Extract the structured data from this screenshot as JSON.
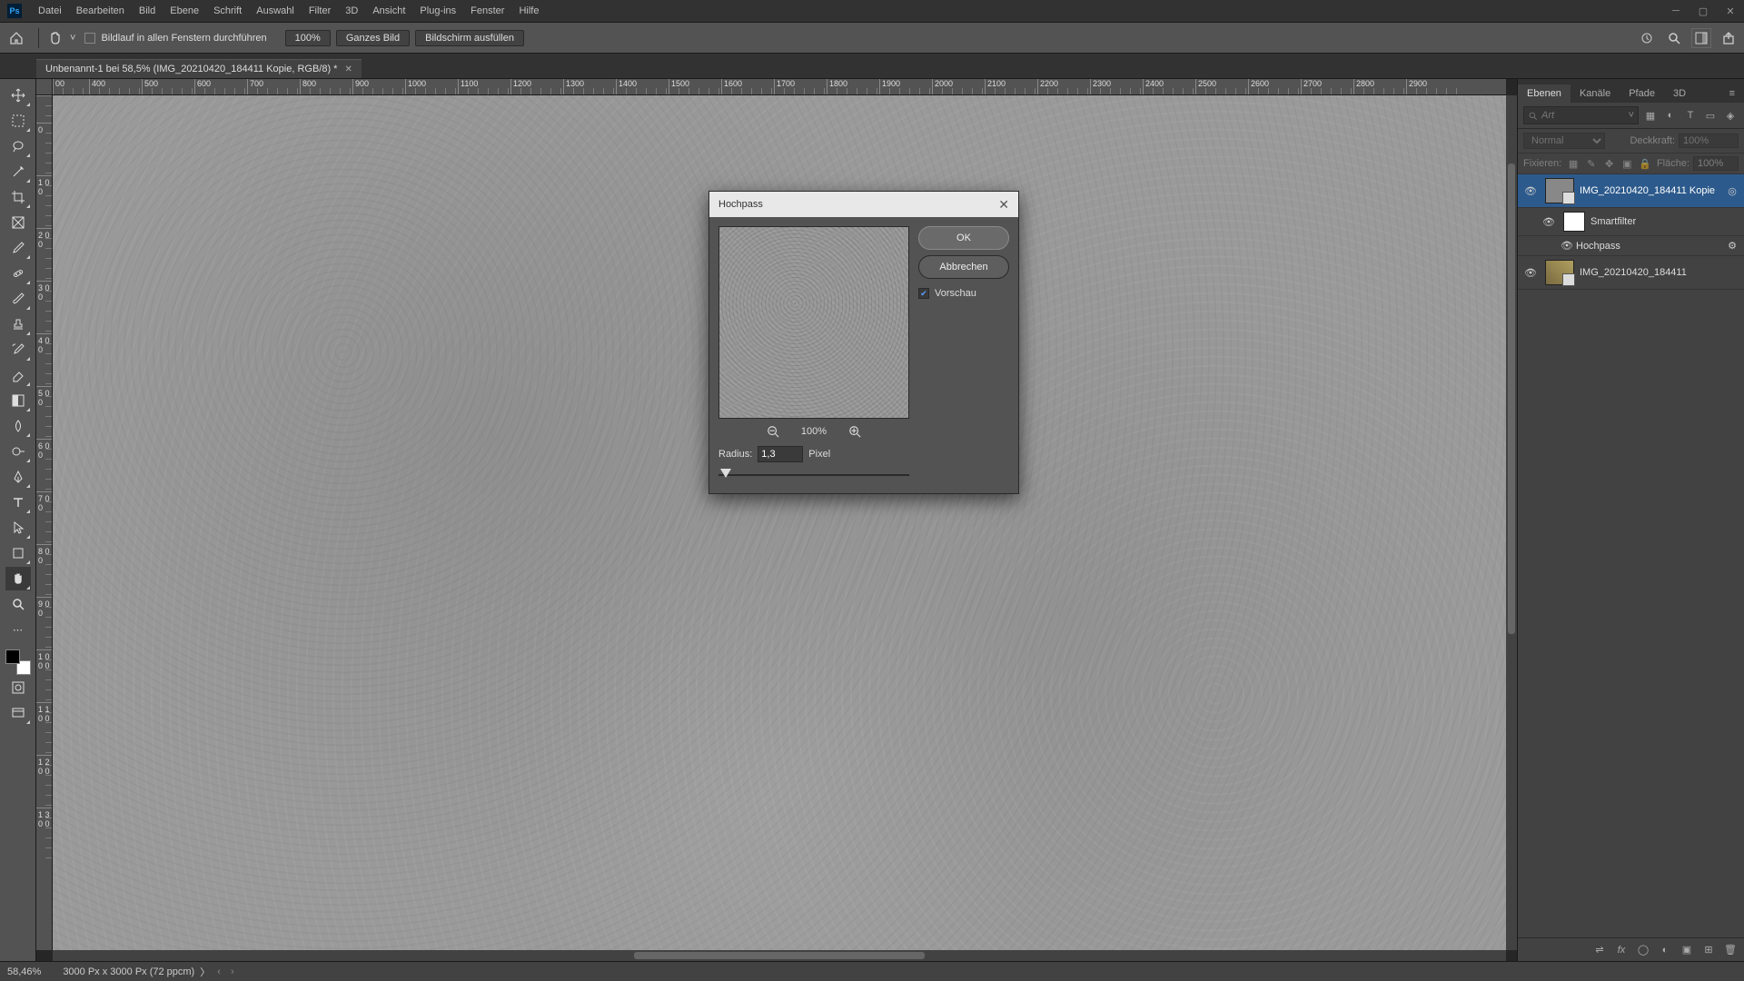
{
  "menu": [
    "Datei",
    "Bearbeiten",
    "Bild",
    "Ebene",
    "Schrift",
    "Auswahl",
    "Filter",
    "3D",
    "Ansicht",
    "Plug-ins",
    "Fenster",
    "Hilfe"
  ],
  "options": {
    "scroll_all": "Bildlauf in allen Fenstern durchführen",
    "zoom": "100%",
    "fit_image": "Ganzes Bild",
    "fill_screen": "Bildschirm ausfüllen"
  },
  "doc_tab": "Unbenannt-1 bei 58,5% (IMG_20210420_184411 Kopie, RGB/8) *",
  "ruler_h": [
    "00",
    "400",
    "500",
    "600",
    "700",
    "800",
    "900",
    "1000",
    "1100",
    "1200",
    "1300",
    "1400",
    "1500",
    "1600",
    "1700",
    "1800",
    "1900",
    "2000",
    "2100",
    "2200",
    "2300",
    "2400",
    "2500",
    "2600",
    "2700",
    "2800",
    "2900"
  ],
  "ruler_v": [
    "",
    "0",
    "1 0 0",
    "2 0 0",
    "3 0 0",
    "4 0 0",
    "5 0 0",
    "6 0 0",
    "7 0 0",
    "8 0 0",
    "9 0 0",
    "1 0 0 0",
    "1 1 0 0",
    "1 2 0 0",
    "1 3 0 0"
  ],
  "dialog": {
    "title": "Hochpass",
    "ok": "OK",
    "cancel": "Abbrechen",
    "preview": "Vorschau",
    "zoom": "100%",
    "radius_label": "Radius:",
    "radius_value": "1,3",
    "pixel": "Pixel"
  },
  "panel": {
    "tabs": [
      "Ebenen",
      "Kanäle",
      "Pfade",
      "3D"
    ],
    "search_placeholder": "Art",
    "blend": "Normal",
    "opacity_label": "Deckkraft:",
    "opacity_value": "100%",
    "lock_label": "Fixieren:",
    "fill_label": "Fläche:",
    "fill_value": "100%",
    "layer1": "IMG_20210420_184411 Kopie",
    "smartfilter": "Smartfilter",
    "hochpass": "Hochpass",
    "layer2": "IMG_20210420_184411"
  },
  "status": {
    "zoom": "58,46%",
    "info": "3000 Px x 3000 Px (72 ppcm)"
  }
}
